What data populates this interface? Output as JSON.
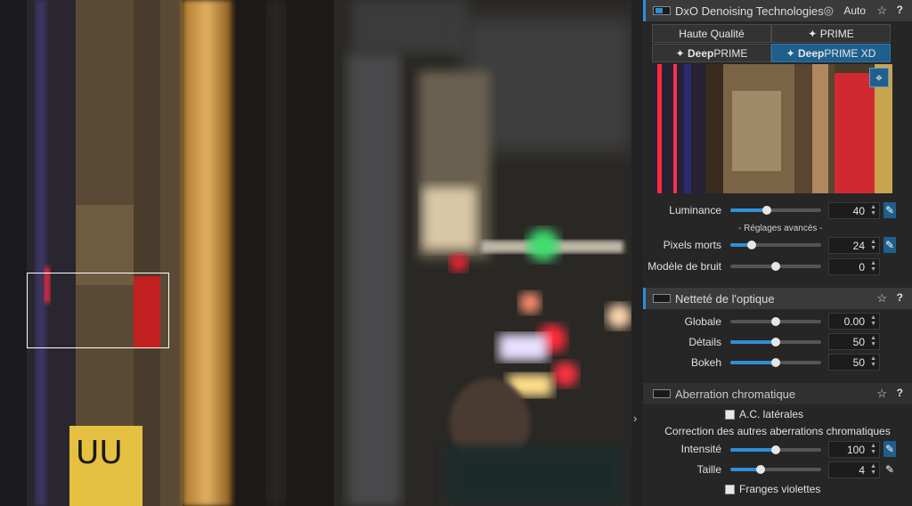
{
  "denoise": {
    "title": "DxO Denoising Technologies",
    "auto_label": "Auto",
    "modes": {
      "hq": "Haute Qualité",
      "prime": "PRIME",
      "deepprime_bold": "Deep",
      "deepprime_rest": "PRIME",
      "deepprimexd_bold": "Deep",
      "deepprimexd_rest": "PRIME XD"
    },
    "active_mode": "DeepPRIME XD",
    "luminance_label": "Luminance",
    "luminance_value": "40",
    "luminance_level": 0.4,
    "advanced_label": "- Réglages avancés -",
    "dead_pixels_label": "Pixels morts",
    "dead_pixels_value": "24",
    "dead_pixels_level": 0.24,
    "noise_model_label": "Modèle de bruit",
    "noise_model_value": "0",
    "noise_model_level": 0.5
  },
  "sharpness": {
    "title": "Netteté de l'optique",
    "global_label": "Globale",
    "global_value": "0.00",
    "global_level": 0.5,
    "details_label": "Détails",
    "details_value": "50",
    "details_level": 0.5,
    "bokeh_label": "Bokeh",
    "bokeh_value": "50",
    "bokeh_level": 0.5
  },
  "chromatic": {
    "title": "Aberration chromatique",
    "lateral_label": "A.C. latérales",
    "other_label": "Correction des autres aberrations chromatiques",
    "intensity_label": "Intensité",
    "intensity_value": "100",
    "intensity_level": 0.5,
    "size_label": "Taille",
    "size_value": "4",
    "size_level": 0.33,
    "fringes_label": "Franges violettes"
  },
  "icons": {
    "star": "☆",
    "help": "?",
    "eye": "eye-off-icon",
    "wand": "magic-wand-icon",
    "target": "crosshair-icon",
    "chevron": "›"
  },
  "colors": {
    "accent": "#2f8fd8",
    "active_button": "#1f5f8b",
    "panel": "#262626"
  }
}
